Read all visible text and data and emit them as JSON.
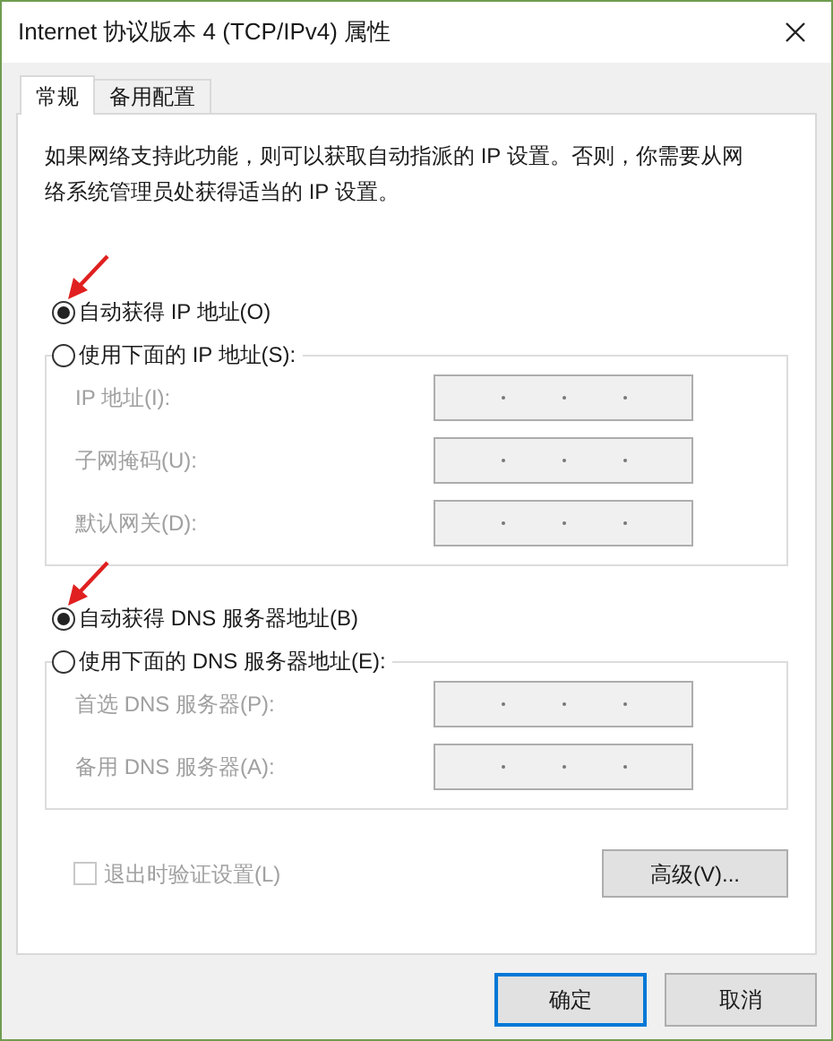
{
  "window": {
    "title": "Internet 协议版本 4 (TCP/IPv4) 属性"
  },
  "tabs": [
    {
      "label": "常规",
      "selected": true
    },
    {
      "label": "备用配置",
      "selected": false
    }
  ],
  "description": "如果网络支持此功能，则可以获取自动指派的 IP 设置。否则，你需要从网络系统管理员处获得适当的 IP 设置。",
  "sections": [
    {
      "auto_option": {
        "label": "自动获得 IP 地址(O)",
        "selected": true,
        "annotated": true
      },
      "manual_option": {
        "label": "使用下面的 IP 地址(S):",
        "selected": false
      },
      "fields": [
        {
          "label": "IP 地址(I):",
          "disabled": true
        },
        {
          "label": "子网掩码(U):",
          "disabled": true
        },
        {
          "label": "默认网关(D):",
          "disabled": true
        }
      ]
    },
    {
      "auto_option": {
        "label": "自动获得 DNS 服务器地址(B)",
        "selected": true,
        "annotated": true
      },
      "manual_option": {
        "label": "使用下面的 DNS 服务器地址(E):",
        "selected": false
      },
      "fields": [
        {
          "label": "首选 DNS 服务器(P):",
          "disabled": true
        },
        {
          "label": "备用 DNS 服务器(A):",
          "disabled": true
        }
      ]
    }
  ],
  "validate_checkbox": {
    "label": "退出时验证设置(L)",
    "checked": false,
    "disabled": true
  },
  "advanced_button": "高级(V)...",
  "buttons": [
    {
      "label": "确定",
      "default": true
    },
    {
      "label": "取消",
      "default": false
    }
  ]
}
